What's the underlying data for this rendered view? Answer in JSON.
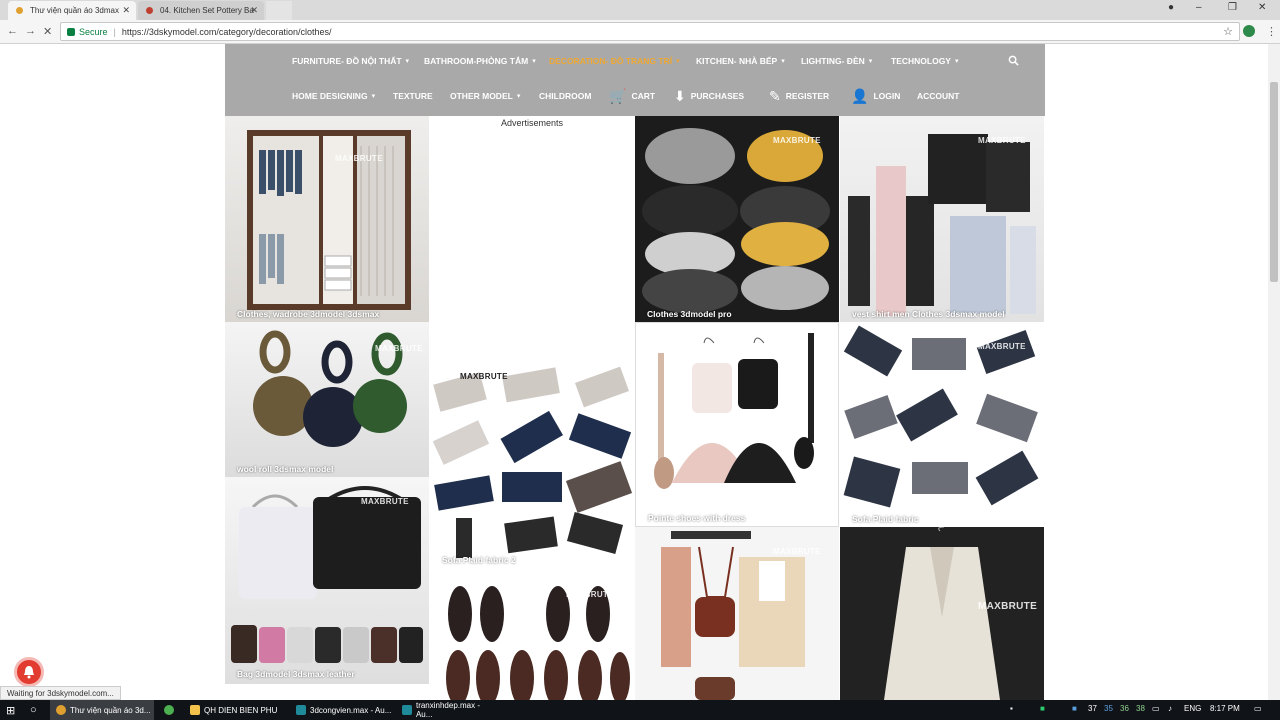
{
  "browser": {
    "tabs": [
      {
        "title": "Thư viện quần áo 3dmax",
        "active": true
      },
      {
        "title": "04. Kitchen Set Pottery Ba",
        "active": false
      }
    ],
    "secure_label": "Secure",
    "url": "https://3dskymodel.com/category/decoration/clothes/",
    "status_text": "Waiting for 3dskymodel.com..."
  },
  "nav": {
    "row1": [
      {
        "label": "FURNITURE- ĐỒ NỘI THẤT",
        "dropdown": true
      },
      {
        "label": "BATHROOM-PHÒNG TẮM",
        "dropdown": true
      },
      {
        "label": "DECORATION- ĐỒ TRANG TRÍ",
        "dropdown": true,
        "active": true
      },
      {
        "label": "KITCHEN- NHÀ BẾP",
        "dropdown": true
      },
      {
        "label": "LIGHTING- ĐÈN",
        "dropdown": true
      },
      {
        "label": "TECHNOLOGY",
        "dropdown": true
      }
    ],
    "row2": [
      {
        "label": "HOME DESIGNING",
        "dropdown": true
      },
      {
        "label": "TEXTURE"
      },
      {
        "label": "OTHER MODEL",
        "dropdown": true
      },
      {
        "label": "CHILDROOM"
      },
      {
        "label": "CART",
        "icon": "cart-icon"
      },
      {
        "label": "PURCHASES",
        "icon": "download-icon"
      },
      {
        "label": "REGISTER",
        "icon": "edit-icon"
      },
      {
        "label": "LOGIN",
        "icon": "user-icon"
      },
      {
        "label": "ACCOUNT"
      }
    ]
  },
  "ads_label": "Advertisements",
  "watermark": "MAXBRUTE",
  "products": [
    {
      "caption": "Clothes, wadrobe 3dmodel 3dsmax"
    },
    {
      "caption": "Clothes 3dmodel pro"
    },
    {
      "caption": "vest shirt men Clothes 3dsmax model"
    },
    {
      "caption": "wool roll 3dsmax model"
    },
    {
      "caption": "Sofa Plaid fabric 2"
    },
    {
      "caption": "Pointe shoes with dress"
    },
    {
      "caption": "Sofa Plaid fabric"
    },
    {
      "caption": "Bag 3dmodel 3dsmax leather"
    },
    {
      "caption": ""
    },
    {
      "caption": ""
    },
    {
      "caption": ""
    }
  ],
  "taskbar": {
    "items": [
      {
        "label": "Thư viện quần áo 3d...",
        "active": true
      },
      {
        "label": ""
      },
      {
        "label": "QH DIEN BIEN PHU"
      },
      {
        "label": "3dcongvien.max - Au..."
      },
      {
        "label": "tranxinhdep.max - Au..."
      }
    ],
    "tray_numbers": [
      "37",
      "35",
      "36",
      "38"
    ],
    "lang": "ENG",
    "time": "8:17 PM"
  },
  "colors": {
    "header_bg": "#a9a9a9",
    "nav_active": "#f0a830",
    "notif": "#e23b30"
  }
}
